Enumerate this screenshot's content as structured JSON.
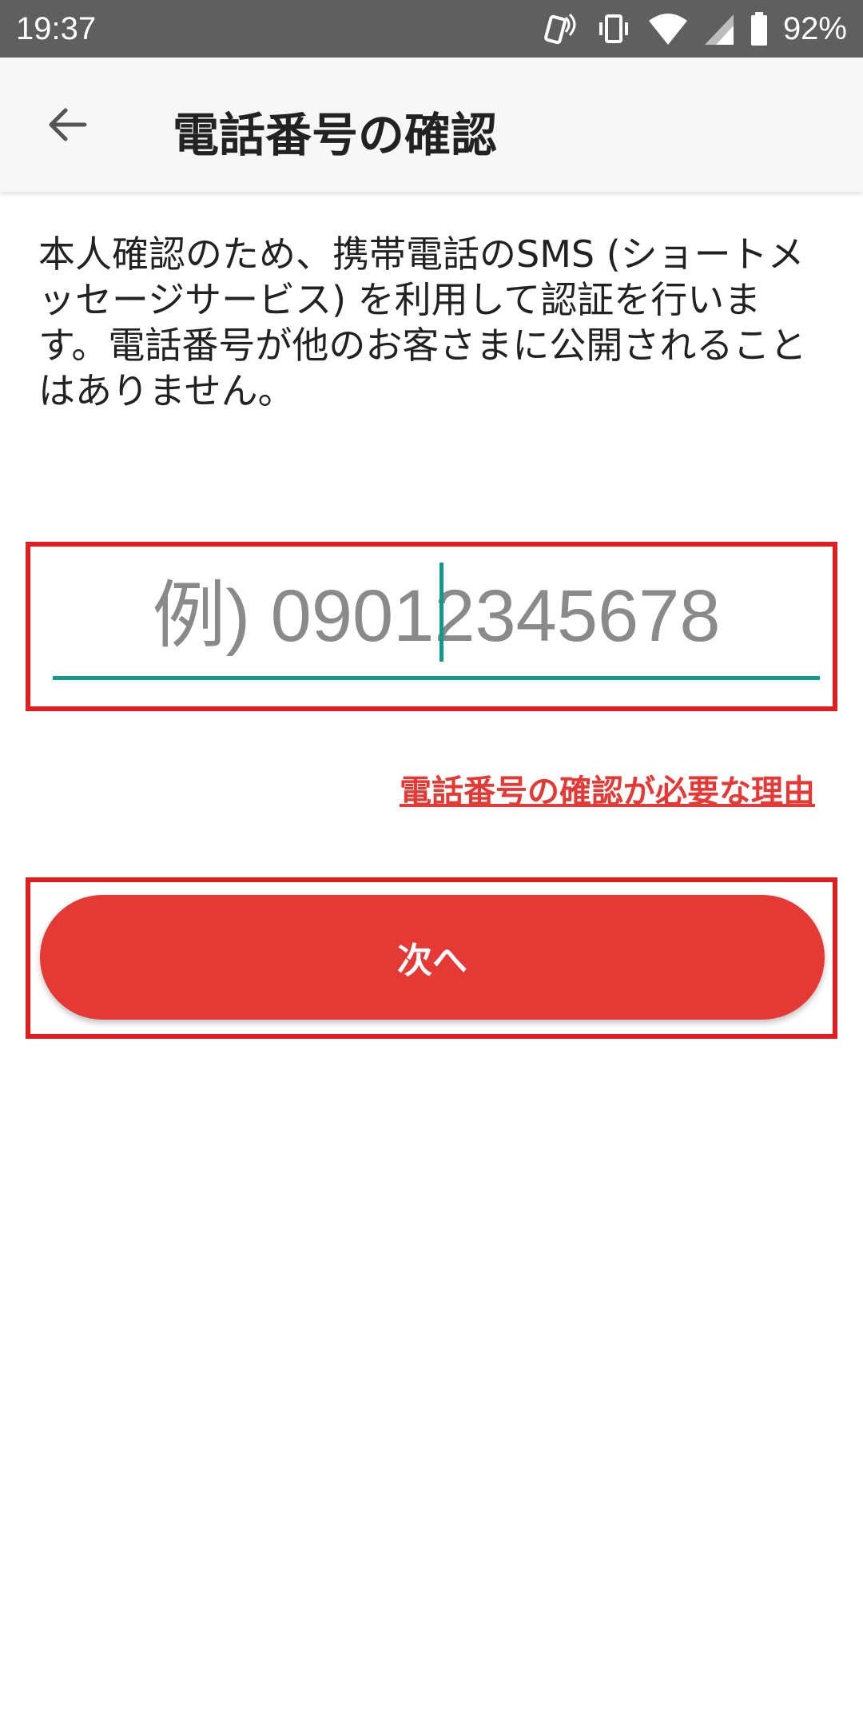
{
  "status_bar": {
    "time": "19:37",
    "battery_percent": "92%",
    "icons": [
      "nfc-phone-icon",
      "vibrate-icon",
      "wifi-icon",
      "cell-signal-icon",
      "battery-icon"
    ]
  },
  "app_bar": {
    "back_icon": "arrow-left-icon",
    "title": "電話番号の確認"
  },
  "description": "本人確認のため、携帯電話のSMS (ショートメッセージサービス) を利用して認証を行います。電話番号が他のお客さまに公開されることはありません。",
  "phone_input": {
    "value": "",
    "placeholder": "例) 09012345678"
  },
  "reason_link": "電話番号の確認が必要な理由",
  "next_button": "次へ",
  "colors": {
    "accent_red": "#e53935",
    "highlight_red": "#e02020",
    "input_teal": "#11998a",
    "status_bar": "#5f5f5f"
  }
}
